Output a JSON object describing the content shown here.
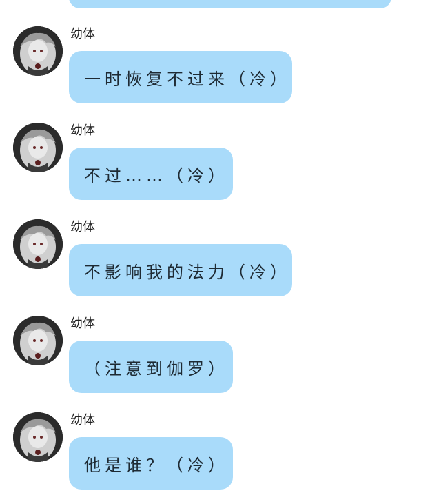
{
  "messages": [
    {
      "sender": "幼体",
      "text": "一时恢复不过来（冷）"
    },
    {
      "sender": "幼体",
      "text": "不过……（冷）"
    },
    {
      "sender": "幼体",
      "text": "不影响我的法力（冷）"
    },
    {
      "sender": "幼体",
      "text": "（注意到伽罗）"
    },
    {
      "sender": "幼体",
      "text": "他是谁？（冷）"
    }
  ],
  "colors": {
    "bubble": "#a9dbfa",
    "background": "#ffffff",
    "text": "#1e2a33"
  }
}
